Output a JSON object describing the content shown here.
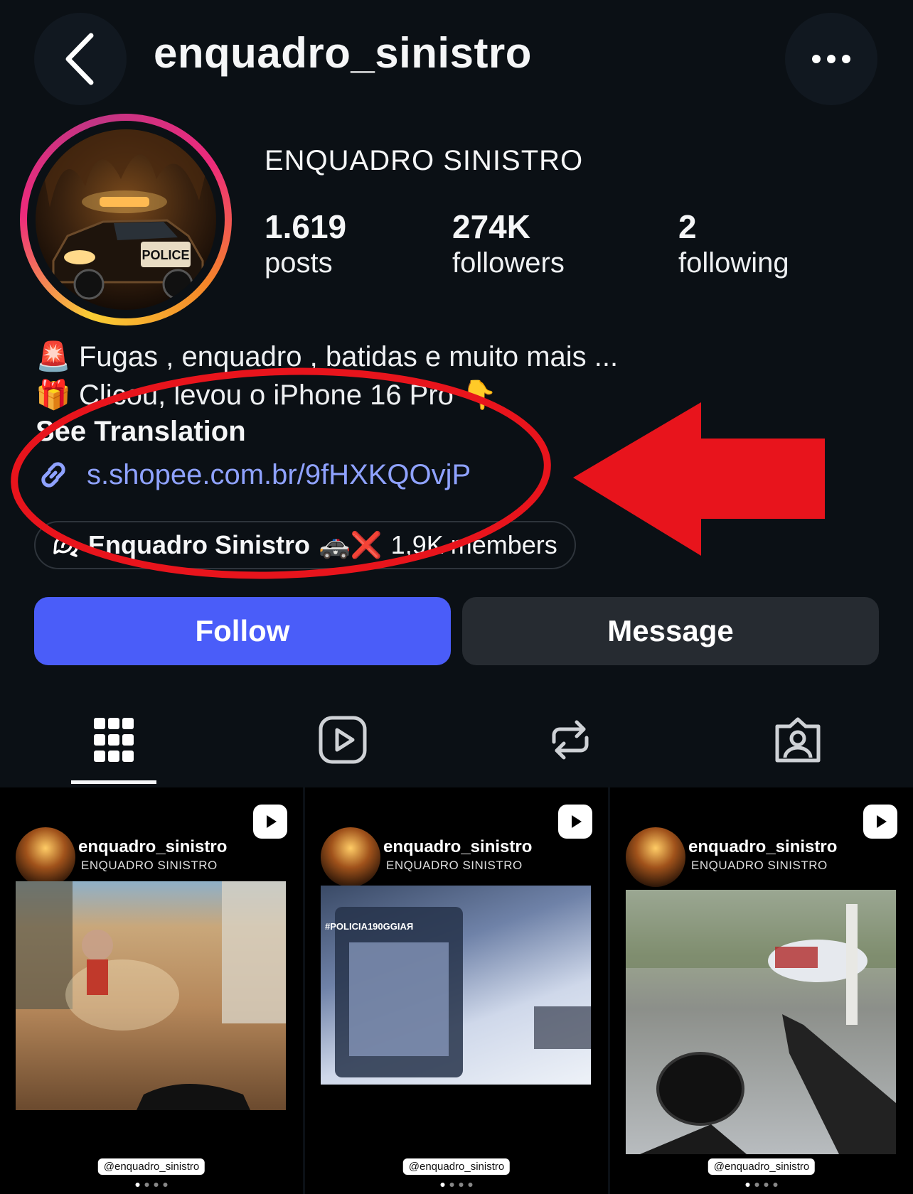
{
  "header": {
    "username": "enquadro_sinistro",
    "back_icon": "chevron-left-icon",
    "more_icon": "more-horizontal-icon"
  },
  "profile": {
    "display_name": "ENQUADRO SINISTRO",
    "posts_count": "1.619",
    "posts_label": "posts",
    "followers_count": "274K",
    "followers_label": "followers",
    "following_count": "2",
    "following_label": "following",
    "avatar_text": "POLICE"
  },
  "bio": {
    "line1_emoji": "🚨",
    "line1_text": "Fugas , enquadro , batidas e muito mais ...",
    "line2_emoji": "🎁",
    "line2_text": "Clicou, levou o iPhone 16 Pro",
    "line2_end_emoji": "👇",
    "see_translation": "See Translation",
    "link": "s.shopee.com.br/9fHXKQOvjP"
  },
  "channel": {
    "name": "Enquadro Sinistro",
    "emoji": "🚓❌",
    "members": "1,9K members"
  },
  "actions": {
    "follow_label": "Follow",
    "message_label": "Message"
  },
  "tabs": [
    "grid-icon",
    "reels-icon",
    "reposts-icon",
    "tagged-icon"
  ],
  "posts": [
    {
      "username": "enquadro_sinistro",
      "subtitle": "ENQUADRO SINISTRO",
      "handle": "@enquadro_sinistro"
    },
    {
      "username": "enquadro_sinistro",
      "subtitle": "ENQUADRO SINISTRO",
      "handle": "@enquadro_sinistro",
      "overlay_text": "#POLICIA190GGIAЯ"
    },
    {
      "username": "enquadro_sinistro",
      "subtitle": "ENQUADRO SINISTRO",
      "handle": "@enquadro_sinistro"
    }
  ],
  "colors": {
    "background": "#0b1015",
    "follow_button": "#4a5df9",
    "message_button": "#262b31",
    "link": "#8fa2ff",
    "annotation_red": "#e8141c"
  }
}
